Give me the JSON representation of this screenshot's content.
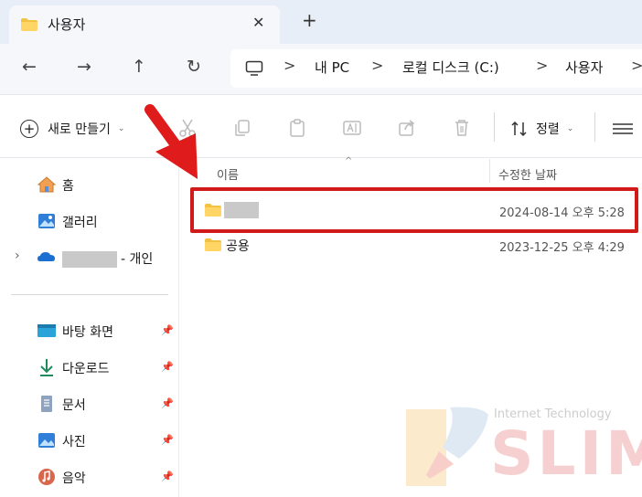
{
  "tab": {
    "title": "사용자",
    "close": "✕",
    "new": "+"
  },
  "nav": {
    "back": "←",
    "forward": "→",
    "up": "↑",
    "refresh": "↻",
    "breadcrumbs": [
      "내 PC",
      "로컬 디스크 (C:)",
      "사용자"
    ],
    "separator": ">"
  },
  "toolbar": {
    "new_label": "새로 만들기",
    "caret": "⌄",
    "sort_label": "정렬"
  },
  "sidebar": {
    "items": [
      {
        "label": "홈",
        "icon": "home-icon"
      },
      {
        "label": "갤러리",
        "icon": "gallery-icon"
      },
      {
        "label": "- 개인",
        "icon": "onedrive-icon",
        "expand": "›"
      },
      {
        "label": "바탕 화면",
        "icon": "desktop-icon",
        "pin": "📌"
      },
      {
        "label": "다운로드",
        "icon": "download-icon",
        "pin": "📌"
      },
      {
        "label": "문서",
        "icon": "documents-icon",
        "pin": "📌"
      },
      {
        "label": "사진",
        "icon": "pictures-icon",
        "pin": "📌"
      },
      {
        "label": "음악",
        "icon": "music-icon",
        "pin": "📌"
      }
    ]
  },
  "columns": {
    "name": "이름",
    "modified": "수정한 날짜",
    "sort_indicator": "^"
  },
  "rows": [
    {
      "name": "",
      "modified": "2024-08-14 오후 5:28",
      "redacted": true
    },
    {
      "name": "공용",
      "modified": "2023-12-25 오후 4:29",
      "redacted": false
    }
  ],
  "watermark": {
    "line1": "Internet Technology",
    "line2": "SLIM"
  },
  "colors": {
    "highlight": "#d11a1a",
    "folder": "#f3c242",
    "tabbar": "#e8eef7"
  }
}
